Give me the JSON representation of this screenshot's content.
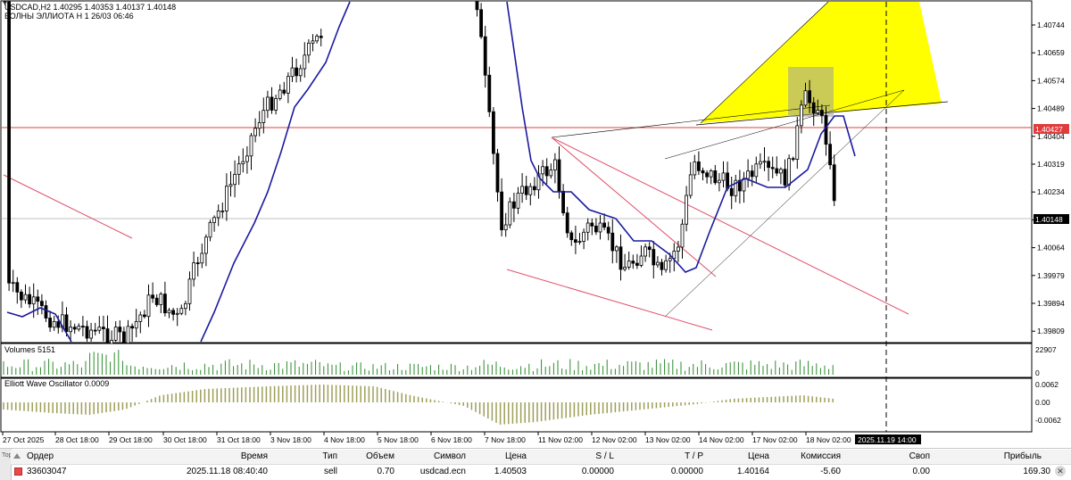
{
  "chart": {
    "header_line1": "USDCAD,H2  1.40295 1.40353 1.40137 1.40148",
    "header_line2": "ВОЛНЫ ЭЛЛИОТА H 1 26/03 06:46",
    "price_ticks": [
      "1.40744",
      "1.40659",
      "1.40574",
      "1.40489",
      "1.40404",
      "1.40319",
      "1.40234",
      "1.40149",
      "1.40064",
      "1.39979",
      "1.39894",
      "1.39809"
    ],
    "current_price_label": "1.40148",
    "red_level_label": "1.40427",
    "time_ticks": [
      "27 Oct 2025",
      "28 Oct 18:00",
      "29 Oct 18:00",
      "30 Oct 18:00",
      "31 Oct 18:00",
      "3 Nov 18:00",
      "4 Nov 18:00",
      "5 Nov 18:00",
      "6 Nov 18:00",
      "7 Nov 18:00",
      "11 Nov 02:00",
      "12 Nov 02:00",
      "13 Nov 02:00",
      "14 Nov 02:00",
      "17 Nov 02:00",
      "18 Nov 02:00"
    ],
    "cursor_time_label": "2025.11.19 14:00",
    "colors": {
      "red_level": "#e03c3c",
      "trend_red": "#e0506a",
      "ma_line": "#1a1aa0",
      "triangle": "#ffff00",
      "box": "#9e9e9e",
      "volume": "#2e8b2e",
      "ewo": "#9e9e58"
    }
  },
  "volumes": {
    "label": "Volumes 5151",
    "max_tick": "22907",
    "zero_tick": "0"
  },
  "oscillator": {
    "label": "Elliott Wave Oscillator 0.0009",
    "top_tick": "0.0062",
    "mid_tick": "0.00",
    "bottom_tick": "-0.0062"
  },
  "terminal": {
    "headers": [
      "Ордер",
      "Время",
      "Тип",
      "Объем",
      "Символ",
      "Цена",
      "S / L",
      "T / P",
      "Цена",
      "Комиссия",
      "Своп",
      "Прибыль"
    ],
    "row": {
      "order": "33603047",
      "time": "2025.11.18 08:40:40",
      "type": "sell",
      "volume": "0.70",
      "symbol": "usdcad.ecn",
      "open_price": "1.40503",
      "sl": "0.00000",
      "tp": "0.00000",
      "price": "1.40164",
      "commission": "-5.60",
      "swap": "0.00",
      "profit": "169.30"
    },
    "side_label": "Тор"
  }
}
